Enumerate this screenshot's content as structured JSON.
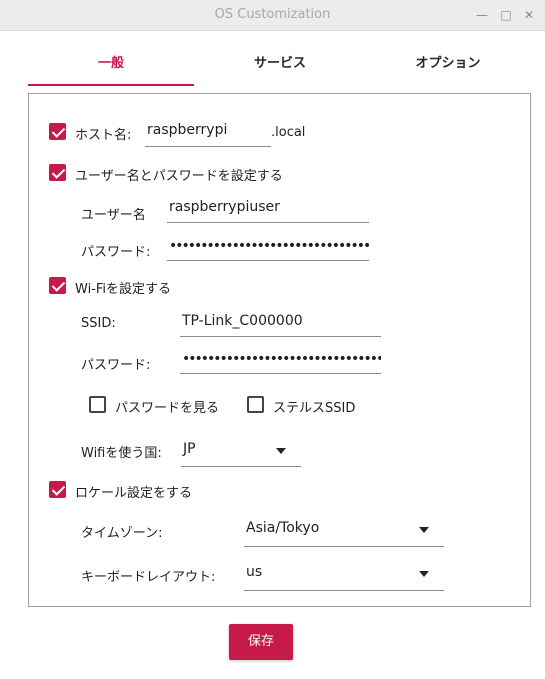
{
  "window": {
    "title": "OS Customization",
    "minimize_glyph": "—",
    "maximize_glyph": "□",
    "close_glyph": "✕"
  },
  "tabs": [
    {
      "label": "一般",
      "active": true
    },
    {
      "label": "サービス",
      "active": false
    },
    {
      "label": "オプション",
      "active": false
    }
  ],
  "hostname": {
    "label": "ホスト名:",
    "checked": true,
    "value": "raspberrypi",
    "suffix": ".local"
  },
  "user": {
    "label": "ユーザー名とパスワードを設定する",
    "checked": true,
    "username_label": "ユーザー名",
    "username_value": "raspberrypiuser",
    "password_label": "パスワード:",
    "password_value": "•••••••••••••••••••••••••••••••••••••••"
  },
  "wifi": {
    "label": "Wi-Fiを設定する",
    "checked": true,
    "ssid_label": "SSID:",
    "ssid_value": "TP-Link_C000000",
    "password_label": "パスワード:",
    "password_value": "•••••••••••••••••••••••••••••••••••••••",
    "show_password_label": "パスワードを見る",
    "show_password_checked": false,
    "hidden_ssid_label": "ステルスSSID",
    "hidden_ssid_checked": false,
    "country_label": "Wifiを使う国:",
    "country_value": "JP"
  },
  "locale": {
    "label": "ロケール設定をする",
    "checked": true,
    "timezone_label": "タイムゾーン:",
    "timezone_value": "Asia/Tokyo",
    "keyboard_label": "キーボードレイアウト:",
    "keyboard_value": "us"
  },
  "save_label": "保存",
  "colors": {
    "accent": "#c51a4a",
    "border": "#9e9e9e"
  }
}
